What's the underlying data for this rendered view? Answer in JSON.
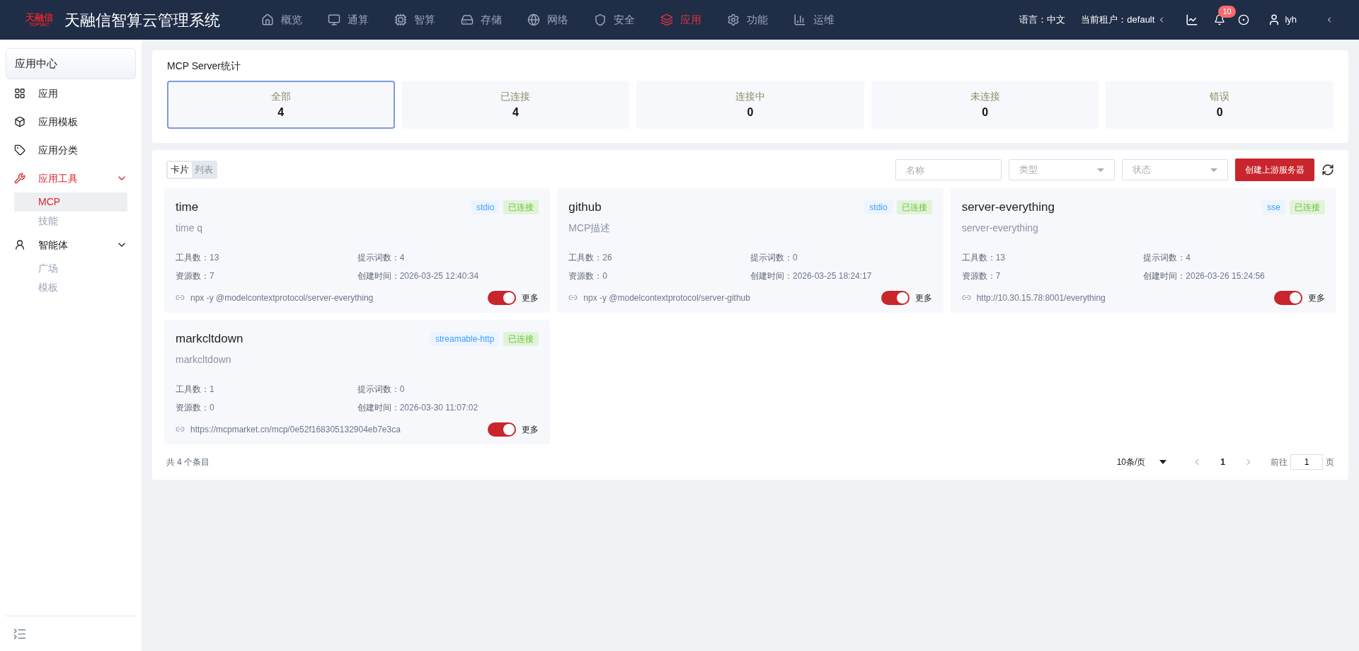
{
  "header": {
    "logo": {
      "name": "天融信",
      "sub": "TOPSEC"
    },
    "title": "天融信智算云管理系统",
    "nav": [
      {
        "label": "概览",
        "selected": false
      },
      {
        "label": "通算",
        "selected": false
      },
      {
        "label": "智算",
        "selected": false
      },
      {
        "label": "存储",
        "selected": false
      },
      {
        "label": "网络",
        "selected": false
      },
      {
        "label": "安全",
        "selected": false
      },
      {
        "label": "应用",
        "selected": true
      },
      {
        "label": "功能",
        "selected": false
      },
      {
        "label": "运维",
        "selected": false
      }
    ],
    "language": "语言：中文",
    "tenant": "当前租户：default",
    "notification_count": "10",
    "user": "lyh"
  },
  "sidebar": {
    "header": "应用中心",
    "items": [
      {
        "label": "应用",
        "selected": false
      },
      {
        "label": "应用模板",
        "selected": false
      },
      {
        "label": "应用分类",
        "selected": false
      },
      {
        "label": "应用工具",
        "selected": false,
        "expanded": true,
        "children": [
          {
            "label": "MCP",
            "selected": true
          },
          {
            "label": "技能",
            "selected": false
          }
        ]
      },
      {
        "label": "智能体",
        "selected": false,
        "expanded": true,
        "children": [
          {
            "label": "广场",
            "selected": false
          },
          {
            "label": "模板",
            "selected": false
          }
        ]
      }
    ]
  },
  "stats": {
    "title": "MCP Server统计",
    "items": [
      {
        "label": "全部",
        "value": "4",
        "selected": true
      },
      {
        "label": "已连接",
        "value": "4",
        "selected": false
      },
      {
        "label": "连接中",
        "value": "0",
        "selected": false
      },
      {
        "label": "未连接",
        "value": "0",
        "selected": false
      },
      {
        "label": "错误",
        "value": "0",
        "selected": false
      }
    ]
  },
  "toolbar": {
    "view_tabs": [
      {
        "label": "卡片",
        "selected": true
      },
      {
        "label": "列表",
        "selected": false
      }
    ],
    "name_placeholder": "名称",
    "type_placeholder": "类型",
    "status_placeholder": "状态",
    "create_button": "创建上游服务器"
  },
  "cards": [
    {
      "name": "time",
      "description": "time q",
      "transport": "stdio",
      "status": "已连接",
      "fields": [
        {
          "label": "工具数：",
          "value": "13"
        },
        {
          "label": "提示词数：",
          "value": "4"
        },
        {
          "label": "资源数：",
          "value": "7"
        },
        {
          "label": "创建时间：",
          "value": "2026-03-25 12:40:34"
        }
      ],
      "command": "npx -y @modelcontextprotocol/server-everything",
      "on": true,
      "more": "更多"
    },
    {
      "name": "github",
      "description": "MCP描述",
      "transport": "stdio",
      "status": "已连接",
      "fields": [
        {
          "label": "工具数：",
          "value": "26"
        },
        {
          "label": "提示词数：",
          "value": "0"
        },
        {
          "label": "资源数：",
          "value": "0"
        },
        {
          "label": "创建时间：",
          "value": "2026-03-25 18:24:17"
        }
      ],
      "command": "npx -y @modelcontextprotocol/server-github",
      "on": true,
      "more": "更多"
    },
    {
      "name": "server-everything",
      "description": "server-everything",
      "transport": "sse",
      "status": "已连接",
      "fields": [
        {
          "label": "工具数：",
          "value": "13"
        },
        {
          "label": "提示词数：",
          "value": "4"
        },
        {
          "label": "资源数：",
          "value": "7"
        },
        {
          "label": "创建时间：",
          "value": "2026-03-26 15:24:56"
        }
      ],
      "command": "http://10.30.15.78:8001/everything",
      "on": true,
      "more": "更多"
    },
    {
      "name": "markcltdown",
      "description": "markcltdown",
      "transport": "streamable-http",
      "status": "已连接",
      "fields": [
        {
          "label": "工具数：",
          "value": "1"
        },
        {
          "label": "提示词数：",
          "value": "0"
        },
        {
          "label": "资源数：",
          "value": "0"
        },
        {
          "label": "创建时间：",
          "value": "2026-03-30 11:07:02"
        }
      ],
      "command": "https://mcpmarket.cn/mcp/0e52f168305132904eb7e3ca",
      "on": true,
      "more": "更多"
    }
  ],
  "pagination": {
    "total": "共 4 个条目",
    "page_size": "10条/页",
    "pages": [
      {
        "label": "1",
        "selected": true
      }
    ],
    "goto_label": "前往",
    "goto_value": "1",
    "page_suffix": "页"
  }
}
